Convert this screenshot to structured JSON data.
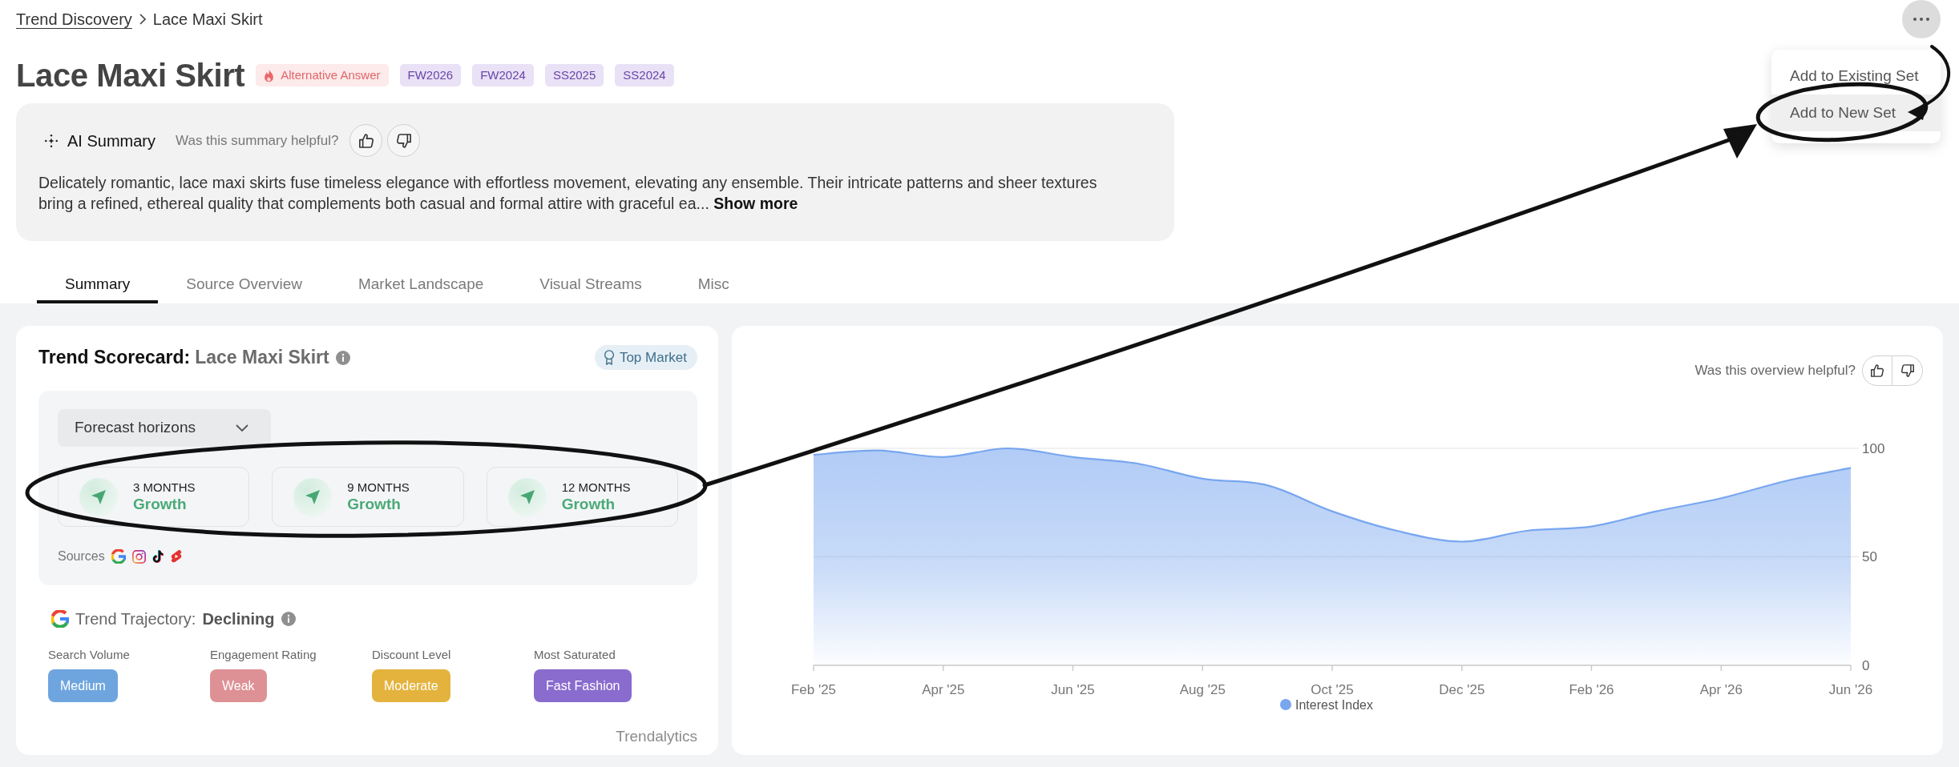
{
  "breadcrumb": [
    {
      "label": "Trend Discovery",
      "current": false
    },
    {
      "label": "Lace Maxi Skirt",
      "current": true
    }
  ],
  "more_menu": {
    "items": [
      {
        "label": "Add to Existing Set",
        "selected": false
      },
      {
        "label": "Add to New Set",
        "selected": true
      }
    ]
  },
  "title": "Lace Maxi Skirt",
  "tags": [
    {
      "label": "Alternative Answer",
      "kind": "alert"
    },
    {
      "label": "FW2026",
      "kind": "season"
    },
    {
      "label": "FW2024",
      "kind": "season"
    },
    {
      "label": "SS2025",
      "kind": "season"
    },
    {
      "label": "SS2024",
      "kind": "season"
    }
  ],
  "ai_summary": {
    "title": "AI Summary",
    "helpful_prompt": "Was this summary helpful?",
    "text": "Delicately romantic, lace maxi skirts fuse timeless elegance with effortless movement, elevating any ensemble. Their intricate patterns and sheer textures bring a refined, ethereal quality that complements both casual and formal attire with graceful ea...",
    "more_link": "Show more"
  },
  "tabs": [
    {
      "label": "Summary",
      "selected": true
    },
    {
      "label": "Source Overview",
      "selected": false
    },
    {
      "label": "Market Landscape",
      "selected": false
    },
    {
      "label": "Visual Streams",
      "selected": false
    },
    {
      "label": "Misc",
      "selected": false
    }
  ],
  "scorecard": {
    "title": "Trend Scorecard:",
    "subject": "Lace Maxi Skirt",
    "badge": "Top Market",
    "dropdown": "Forecast horizons",
    "horizons": [
      {
        "period": "3 MONTHS",
        "outlook": "Growth"
      },
      {
        "period": "9 MONTHS",
        "outlook": "Growth"
      },
      {
        "period": "12 MONTHS",
        "outlook": "Growth"
      }
    ],
    "sources_label": "Sources",
    "sources": [
      {
        "kind": "google"
      },
      {
        "kind": "instagram"
      },
      {
        "kind": "tiktok"
      },
      {
        "kind": "shorts"
      }
    ],
    "trajectory_label": "Trend Trajectory:",
    "trajectory": "Declining",
    "metrics": [
      {
        "label": "Search Volume",
        "value": "Medium",
        "color": "#6fa5df"
      },
      {
        "label": "Engagement Rating",
        "value": "Weak",
        "color": "#de9195"
      },
      {
        "label": "Discount Level",
        "value": "Moderate",
        "color": "#e4b33e"
      },
      {
        "label": "Most Saturated",
        "value": "Fast Fashion",
        "color": "#8a6bce"
      }
    ],
    "brand": "Trendalytics"
  },
  "overview": {
    "helpful_prompt": "Was this overview helpful?",
    "chart_data": {
      "type": "area",
      "categories": [
        "Feb '25",
        null,
        "Apr '25",
        null,
        "Jun '25",
        null,
        "Aug '25",
        null,
        "Oct '25",
        null,
        "Dec '25",
        null,
        "Feb '26",
        null,
        "Apr '26",
        null,
        "Jun '26"
      ],
      "series": [
        {
          "name": "Interest Index",
          "color": "#78a6ef",
          "values": [
            97,
            99,
            96,
            100,
            96,
            93,
            86,
            83,
            71,
            62,
            57,
            62,
            64,
            71,
            77,
            85,
            91
          ]
        }
      ],
      "ylim": [
        0,
        100
      ],
      "yticks": [
        0,
        50,
        100
      ]
    }
  }
}
